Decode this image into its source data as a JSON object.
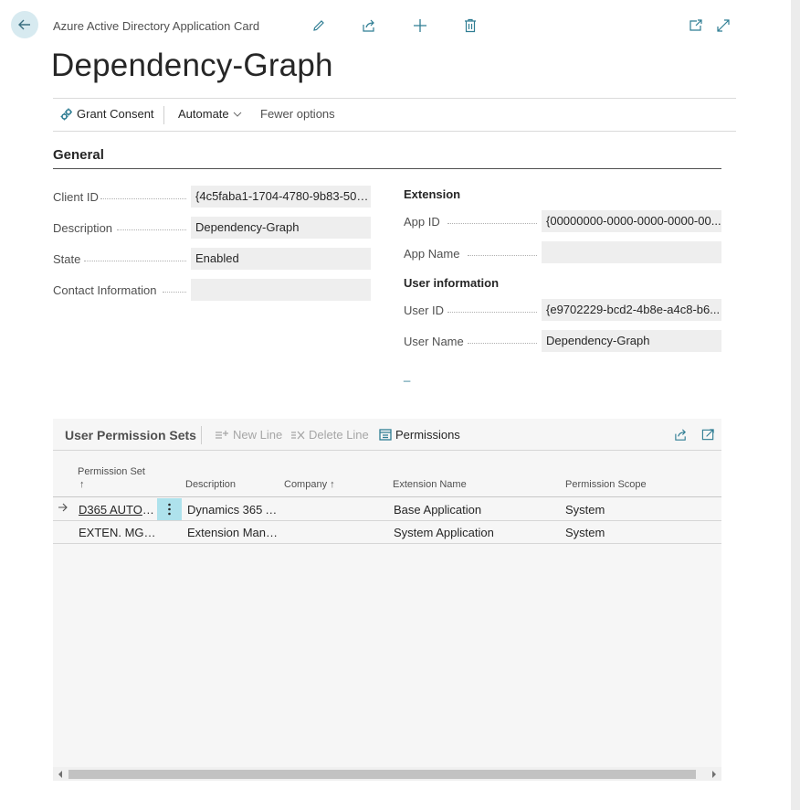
{
  "header": {
    "breadcrumb": "Azure Active Directory Application Card",
    "title": "Dependency-Graph"
  },
  "actions": {
    "grant_consent": "Grant Consent",
    "automate": "Automate",
    "fewer_options": "Fewer options"
  },
  "general": {
    "section_title": "General",
    "client_id_label": "Client ID",
    "client_id_value": "{4c5faba1-1704-4780-9b83-505...",
    "description_label": "Description",
    "description_value": "Dependency-Graph",
    "state_label": "State",
    "state_value": "Enabled",
    "contact_label": "Contact Information",
    "contact_value": "",
    "extension_title": "Extension",
    "app_id_label": "App ID",
    "app_id_value": "{00000000-0000-0000-0000-00...",
    "app_name_label": "App Name",
    "app_name_value": "",
    "user_info_title": "User information",
    "user_id_label": "User ID",
    "user_id_value": "{e9702229-bcd2-4b8e-a4c8-b6...",
    "user_name_label": "User Name",
    "user_name_value": "Dependency-Graph",
    "extra_mark": "_"
  },
  "permissions": {
    "part_title": "User Permission Sets",
    "new_line": "New Line",
    "delete_line": "Delete Line",
    "permissions_btn": "Permissions",
    "columns": {
      "permission_set": "Permission Set",
      "sort_arrow": "↑",
      "description": "Description",
      "company": "Company ↑",
      "extension_name": "Extension Name",
      "permission_scope": "Permission Scope"
    },
    "rows": [
      {
        "permission_set": "D365 AUTOM...",
        "description": "Dynamics 365 A...",
        "company": "",
        "extension_name": "Base Application",
        "scope": "System"
      },
      {
        "permission_set": "EXTEN. MGT. ...",
        "description": "Extension Mana...",
        "company": "",
        "extension_name": "System Application",
        "scope": "System"
      }
    ]
  },
  "icons": {
    "back": "arrow-left-icon",
    "edit": "pencil-icon",
    "share": "share-icon",
    "add": "plus-icon",
    "delete": "trash-icon",
    "open_new": "open-new-window-icon",
    "expand": "expand-icon"
  },
  "colors": {
    "accent": "#00a3c4",
    "back_bg": "#d7eaf0",
    "field_bg": "#eeeeee",
    "part_bg": "#f6f6f6"
  }
}
